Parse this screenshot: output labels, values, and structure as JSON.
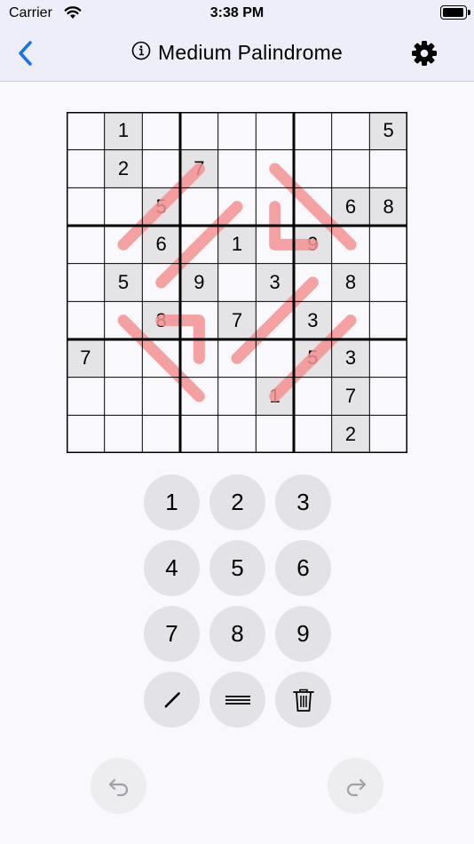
{
  "status_bar": {
    "carrier": "Carrier",
    "time": "3:38 PM",
    "battery_level": 0.95
  },
  "nav": {
    "title": "Medium Palindrome",
    "icons": [
      "chevron-left-icon",
      "info-icon",
      "gear-icon"
    ]
  },
  "puzzle": {
    "highlight_color": "#e4e4e6",
    "line_color": "#f49191",
    "cells": [
      {
        "r": 0,
        "c": 1,
        "v": "1"
      },
      {
        "r": 0,
        "c": 8,
        "v": "5"
      },
      {
        "r": 1,
        "c": 1,
        "v": "2"
      },
      {
        "r": 1,
        "c": 3,
        "v": "7"
      },
      {
        "r": 2,
        "c": 2,
        "v": "5"
      },
      {
        "r": 2,
        "c": 7,
        "v": "6"
      },
      {
        "r": 2,
        "c": 8,
        "v": "8"
      },
      {
        "r": 3,
        "c": 2,
        "v": "6"
      },
      {
        "r": 3,
        "c": 4,
        "v": "1"
      },
      {
        "r": 3,
        "c": 6,
        "v": "9"
      },
      {
        "r": 4,
        "c": 1,
        "v": "5"
      },
      {
        "r": 4,
        "c": 3,
        "v": "9"
      },
      {
        "r": 4,
        "c": 5,
        "v": "3"
      },
      {
        "r": 4,
        "c": 7,
        "v": "8"
      },
      {
        "r": 5,
        "c": 2,
        "v": "8"
      },
      {
        "r": 5,
        "c": 4,
        "v": "7"
      },
      {
        "r": 5,
        "c": 6,
        "v": "3"
      },
      {
        "r": 6,
        "c": 0,
        "v": "7"
      },
      {
        "r": 6,
        "c": 6,
        "v": "5"
      },
      {
        "r": 6,
        "c": 7,
        "v": "3"
      },
      {
        "r": 7,
        "c": 5,
        "v": "1"
      },
      {
        "r": 7,
        "c": 7,
        "v": "7"
      },
      {
        "r": 8,
        "c": 7,
        "v": "2"
      }
    ],
    "palindrome_lines": [
      [
        [
          1,
          3
        ],
        [
          2,
          2
        ],
        [
          3,
          1
        ]
      ],
      [
        [
          2,
          4
        ],
        [
          3,
          3
        ],
        [
          4,
          2
        ]
      ],
      [
        [
          1,
          5
        ],
        [
          2,
          6
        ],
        [
          3,
          7
        ]
      ],
      [
        [
          2,
          5
        ],
        [
          3,
          5
        ],
        [
          3,
          6
        ]
      ],
      [
        [
          5,
          1
        ],
        [
          6,
          2
        ],
        [
          7,
          3
        ]
      ],
      [
        [
          5,
          2
        ],
        [
          5,
          3
        ],
        [
          6,
          3
        ]
      ],
      [
        [
          4,
          6
        ],
        [
          5,
          5
        ],
        [
          6,
          4
        ]
      ],
      [
        [
          5,
          7
        ],
        [
          6,
          6
        ],
        [
          7,
          5
        ]
      ]
    ]
  },
  "keypad": {
    "digits": [
      "1",
      "2",
      "3",
      "4",
      "5",
      "6",
      "7",
      "8",
      "9"
    ],
    "tools": [
      {
        "name": "pencil-button",
        "icon": "pencil-icon"
      },
      {
        "name": "notes-button",
        "icon": "lines-icon"
      },
      {
        "name": "delete-button",
        "icon": "trash-icon"
      }
    ]
  },
  "history": {
    "undo_icon": "undo-icon",
    "redo_icon": "redo-icon"
  }
}
